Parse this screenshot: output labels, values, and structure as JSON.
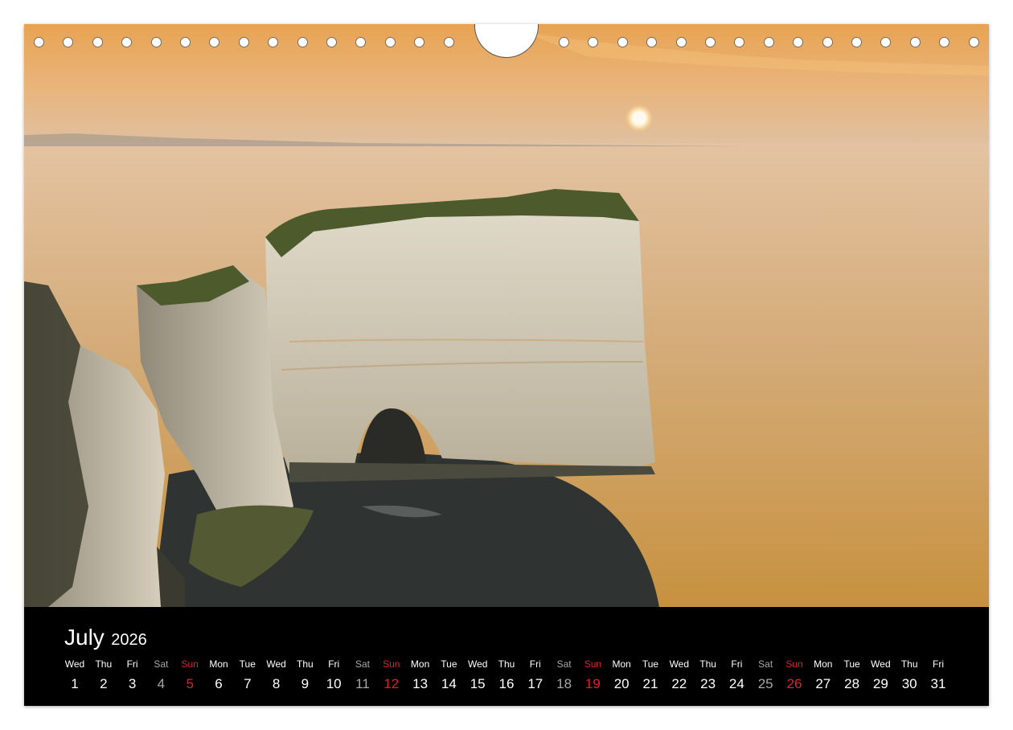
{
  "calendar": {
    "month": "July",
    "year": "2026",
    "days": [
      {
        "weekday": "Wed",
        "num": "1",
        "type": "weekday"
      },
      {
        "weekday": "Thu",
        "num": "2",
        "type": "weekday"
      },
      {
        "weekday": "Fri",
        "num": "3",
        "type": "weekday"
      },
      {
        "weekday": "Sat",
        "num": "4",
        "type": "sat"
      },
      {
        "weekday": "Sun",
        "num": "5",
        "type": "sun"
      },
      {
        "weekday": "Mon",
        "num": "6",
        "type": "weekday"
      },
      {
        "weekday": "Tue",
        "num": "7",
        "type": "weekday"
      },
      {
        "weekday": "Wed",
        "num": "8",
        "type": "weekday"
      },
      {
        "weekday": "Thu",
        "num": "9",
        "type": "weekday"
      },
      {
        "weekday": "Fri",
        "num": "10",
        "type": "weekday"
      },
      {
        "weekday": "Sat",
        "num": "11",
        "type": "sat"
      },
      {
        "weekday": "Sun",
        "num": "12",
        "type": "sun"
      },
      {
        "weekday": "Mon",
        "num": "13",
        "type": "weekday"
      },
      {
        "weekday": "Tue",
        "num": "14",
        "type": "weekday"
      },
      {
        "weekday": "Wed",
        "num": "15",
        "type": "weekday"
      },
      {
        "weekday": "Thu",
        "num": "16",
        "type": "weekday"
      },
      {
        "weekday": "Fri",
        "num": "17",
        "type": "weekday"
      },
      {
        "weekday": "Sat",
        "num": "18",
        "type": "sat"
      },
      {
        "weekday": "Sun",
        "num": "19",
        "type": "sun"
      },
      {
        "weekday": "Mon",
        "num": "20",
        "type": "weekday"
      },
      {
        "weekday": "Tue",
        "num": "21",
        "type": "weekday"
      },
      {
        "weekday": "Wed",
        "num": "22",
        "type": "weekday"
      },
      {
        "weekday": "Thu",
        "num": "23",
        "type": "weekday"
      },
      {
        "weekday": "Fri",
        "num": "24",
        "type": "weekday"
      },
      {
        "weekday": "Sat",
        "num": "25",
        "type": "sat"
      },
      {
        "weekday": "Sun",
        "num": "26",
        "type": "sun"
      },
      {
        "weekday": "Mon",
        "num": "27",
        "type": "weekday"
      },
      {
        "weekday": "Tue",
        "num": "28",
        "type": "weekday"
      },
      {
        "weekday": "Wed",
        "num": "29",
        "type": "weekday"
      },
      {
        "weekday": "Thu",
        "num": "30",
        "type": "weekday"
      },
      {
        "weekday": "Fri",
        "num": "31",
        "type": "weekday"
      }
    ]
  },
  "colors": {
    "sunday": "#e0202a",
    "saturday": "#a8a8a8",
    "weekday": "#ffffff",
    "bar_background": "#000000"
  },
  "photo": {
    "icon": "sea-stack-sunset-photo"
  }
}
